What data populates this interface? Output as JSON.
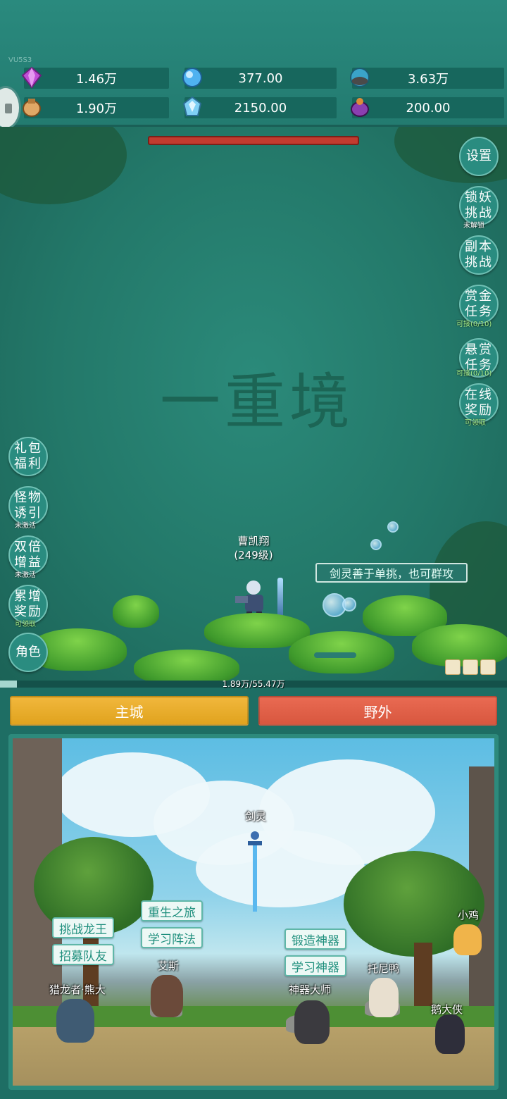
{
  "version": "VU5S3",
  "resources": [
    {
      "icon": "purple-gem-icon",
      "value": "1.46万",
      "color": "#c04dd6"
    },
    {
      "icon": "blue-crystal-icon",
      "value": "377.00",
      "color": "#4fb2f0"
    },
    {
      "icon": "world-orb-icon",
      "value": "3.63万",
      "color": "#3aa3c9"
    },
    {
      "icon": "seed-pouch-icon",
      "value": "1.90万",
      "color": "#e0a866"
    },
    {
      "icon": "ice-crystal-icon",
      "value": "2150.00",
      "color": "#7fd0f5"
    },
    {
      "icon": "magic-pot-icon",
      "value": "200.00",
      "color": "#8a3fb0"
    }
  ],
  "battle": {
    "realm_text": "一重境",
    "hero": {
      "name": "曹凯翔",
      "level": "(249级)"
    },
    "speech": "剑灵善于单挑，也可群攻",
    "boss_hp_fraction": 1.0
  },
  "right_buttons": [
    {
      "label": "设置",
      "sub": ""
    },
    {
      "label": "锁妖挑战",
      "sub": "未解锁"
    },
    {
      "label": "副本挑战",
      "sub": ""
    },
    {
      "label": "赏金任务",
      "sub": "可接(0/10)"
    },
    {
      "label": "悬赏任务",
      "sub": "可接(0/10)"
    },
    {
      "label": "在线奖励",
      "sub": "可领取"
    }
  ],
  "left_buttons": [
    {
      "label": "礼包福利",
      "sub": ""
    },
    {
      "label": "怪物诱引",
      "sub": "未激活"
    },
    {
      "label": "双倍增益",
      "sub": "未激活"
    },
    {
      "label": "累增奖励",
      "sub": "可领取"
    },
    {
      "label": "角色",
      "sub": ""
    }
  ],
  "xp": {
    "text": "1.89万/55.47万",
    "fraction": 0.034
  },
  "tabs": {
    "city": "主城",
    "field": "野外"
  },
  "town": {
    "labels": {
      "sword_spirit": "剑灵",
      "dragon_hunter": "猎龙者·熊大",
      "ais": "艾斯",
      "artifact_master": "神器大师",
      "tony_duck": "托尼鸭",
      "chick": "小鸡",
      "goose_hero": "鹅大侠"
    },
    "buttons": {
      "challenge_dragon": "挑战龙王",
      "recruit_team": "招募队友",
      "rebirth": "重生之旅",
      "learn_formation": "学习阵法",
      "forge_artifact": "锻造神器",
      "learn_artifact": "学习神器"
    }
  }
}
